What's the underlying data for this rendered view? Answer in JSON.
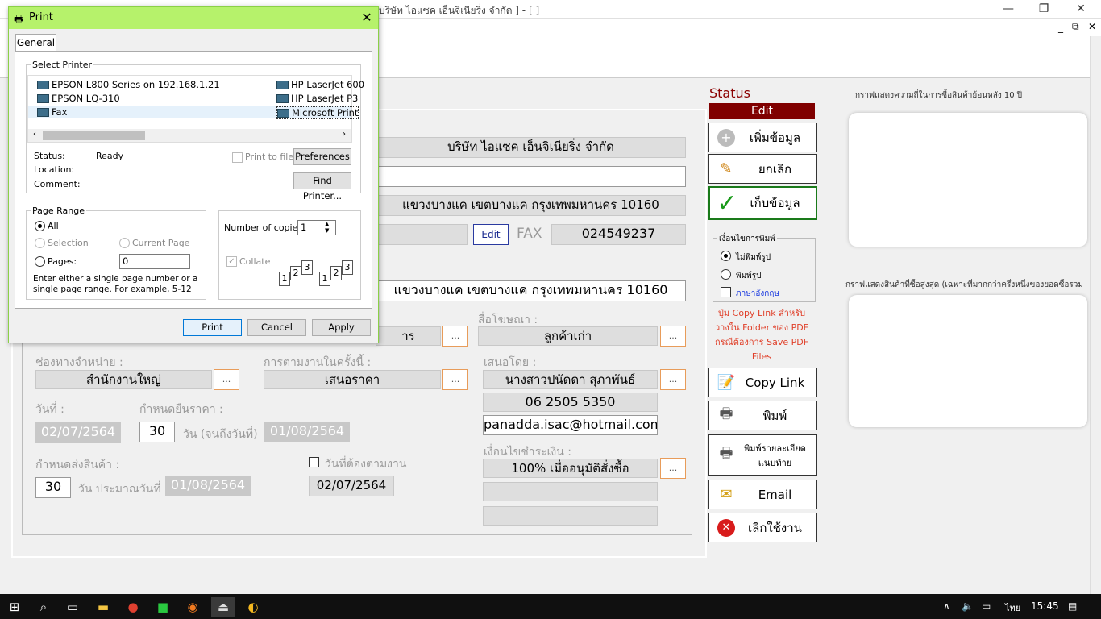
{
  "main_window": {
    "title": "บริษัท ไอแซค เอ็นจิเนียริ่ง จำกัด ] - [ ]",
    "mdi_controls": {
      "minimize": "_",
      "restore": "⧉",
      "close": "✕"
    }
  },
  "form": {
    "company_name": "บริษัท ไอแซค เอ็นจิเนียริ่ง จำกัด",
    "address_line": "แขวงบางแค  เขตบางแค  กรุงเทพมหานคร  10160",
    "edit_button": "Edit",
    "fax_label": "FAX",
    "fax_value": "024549237",
    "delivery_address": "แขวงบางแค  เขตบางแค  กรุงเทพมหานคร  10160",
    "media_label": "สื่อโฆษณา :",
    "media_value": "ลูกค้าเก่า",
    "partial_field_value": "าร",
    "channel_label": "ช่องทางจำหน่าย  :",
    "channel_value": "สำนักงานใหญ่",
    "followup_label": "การตามงานในครั้งนี้ :",
    "followup_value": "เสนอราคา",
    "proposer_label": "เสนอโดย :",
    "proposer_name": "นางสาวปนัดดา สุภาพันธ์",
    "proposer_phone": "06 2505 5350",
    "proposer_email": "panadda.isac@hotmail.com",
    "date_label": "วันที่ :",
    "date_value": "02/07/2564",
    "validity_label": "กำหนดยืนราคา :",
    "validity_days": "30",
    "validity_unit": "วัน (จนถึงวันที่)",
    "validity_until": "01/08/2564",
    "delivery_label": "กำหนดส่งสินค้า :",
    "delivery_days": "30",
    "delivery_unit": "วัน ประมาณวันที่",
    "delivery_date": "01/08/2564",
    "followup_date_label": "วันที่ต้องตามงาน",
    "followup_date": "02/07/2564",
    "payment_label": "เงื่อนไขชำระเงิน :",
    "payment_value": "100% เมื่ออนุมัติสั่งซื้อ",
    "dots": "..."
  },
  "side": {
    "status_label": "Status",
    "status_value": "Edit",
    "add_button": "เพิ่มข้อมูล",
    "cancel_button": "ยกเลิก",
    "save_button": "เก็บข้อมูล",
    "print_options_title": "เงื่อนไขการพิมพ์",
    "opt_no_format": "ไม่พิมพ์รูป",
    "opt_with_format": "พิมพ์รูป",
    "opt_english": "ภาษาอังกฤษ",
    "copy_hint": "ปุ่ม Copy Link สำหรับ วางใน Folder ของ PDF กรณีต้องการ Save PDF Files",
    "copy_link_button": "Copy Link",
    "print_button": "พิมพ์",
    "print_detail_button": "พิมพ์รายละเอียด แนบท้าย",
    "email_button": "Email",
    "exit_button": "เลิกใช้งาน"
  },
  "charts": {
    "history_title": "กราฟแสดงความถี่ในการซื้อสินค้าย้อนหลัง 10 ปี",
    "top_title": "กราฟแสดงสินค้าที่ซื้อสูงสุด (เฉพาะที่มากกว่าครึ่งหนึ่งของยอดซื้อรวม"
  },
  "print_dialog": {
    "title": "Print",
    "tab_general": "General",
    "select_printer_label": "Select Printer",
    "printers": [
      "EPSON L800 Series on 192.168.1.21",
      "EPSON LQ-310",
      "Fax",
      "HP LaserJet 600",
      "HP LaserJet P3",
      "Microsoft Print"
    ],
    "status_label": "Status:",
    "status_value": "Ready",
    "location_label": "Location:",
    "comment_label": "Comment:",
    "print_to_file": "Print to file",
    "preferences_button": "Preferences",
    "find_printer_button": "Find Printer...",
    "page_range_label": "Page Range",
    "range_all": "All",
    "range_selection": "Selection",
    "range_current": "Current Page",
    "range_pages": "Pages:",
    "pages_value": "0",
    "range_hint": "Enter either a single page number or a single page range.  For example, 5-12",
    "copies_label": "Number of copies:",
    "copies_value": "1",
    "collate_label": "Collate",
    "print_button": "Print",
    "cancel_button": "Cancel",
    "apply_button": "Apply"
  },
  "taskbar": {
    "language": "ไทย",
    "time": "15:45"
  }
}
